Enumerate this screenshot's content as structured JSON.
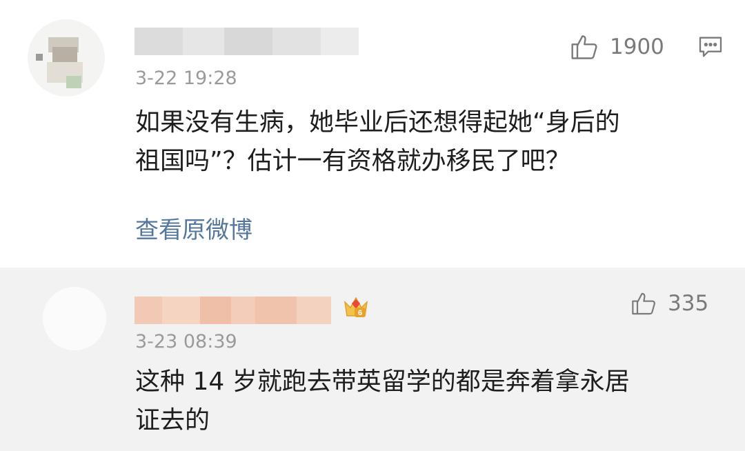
{
  "comments": [
    {
      "time": "3-22 19:28",
      "content_lines": [
        "如果没有生病，她毕业后还想得起她“身后的",
        "祖国吗”？估计一有资格就办移民了吧？"
      ],
      "likes": "1900",
      "link": "查看原微博",
      "icons": [
        "thumbs-up-icon",
        "reply-icon"
      ]
    },
    {
      "time": "3-23 08:39",
      "content_lines": [
        "这种 14 岁就跑去带英留学的都是奔着拿永居",
        "证去的"
      ],
      "likes": "335",
      "badge_level": "6",
      "icons": [
        "thumbs-up-icon",
        "crown-badge-icon"
      ]
    }
  ]
}
